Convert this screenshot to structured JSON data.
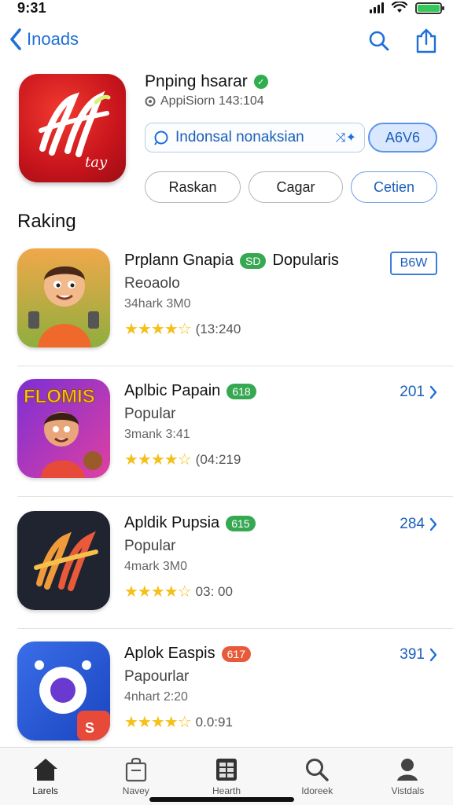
{
  "status": {
    "time": "9:31",
    "battery_level": 1.0,
    "battery_color": "#34c759"
  },
  "nav": {
    "back_label": "Inoads",
    "accent": "#1e6fd9"
  },
  "app": {
    "title": "Pnping hsarar",
    "subtitle": "AppiSiorn 143:104",
    "search_text": "Indonsal nonaksian",
    "primary_button": "A6V6",
    "chips": [
      "Raskan",
      "Cagar",
      "Cetien"
    ]
  },
  "section": {
    "title": "Raking"
  },
  "rows": [
    {
      "title": "Prplann Gnapia",
      "badge": "SD",
      "badge_color": "green",
      "extra": "Dopularis",
      "sub": "Reoaolo",
      "meta": "34hark 3M0",
      "stars": "★★★★☆",
      "rating_count": "(13:240",
      "action": "B6W",
      "action_style": "box"
    },
    {
      "title": "Aplbic Papain",
      "badge": "618",
      "badge_color": "green",
      "extra": "",
      "sub": "Popular",
      "meta": "3mank 3:41",
      "stars": "★★★★☆",
      "rating_count": "(04:219",
      "action": "201",
      "action_style": "link"
    },
    {
      "title": "Apldik Pupsia",
      "badge": "615",
      "badge_color": "green",
      "extra": "",
      "sub": "Popular",
      "meta": "4mark 3M0",
      "stars": "★★★★☆",
      "rating_count": "03: 00",
      "action": "284",
      "action_style": "link"
    },
    {
      "title": "Aplok Easpis",
      "badge": "617",
      "badge_color": "orange",
      "extra": "",
      "sub": "Papourlar",
      "meta": "4nhart 2:20",
      "stars": "★★★★☆",
      "rating_count": "0.0:91",
      "action": "391",
      "action_style": "link"
    }
  ],
  "tabs": [
    {
      "label": "Larels",
      "icon": "home-icon"
    },
    {
      "label": "Navey",
      "icon": "bag-icon"
    },
    {
      "label": "Hearth",
      "icon": "grid-icon"
    },
    {
      "label": "Idoreek",
      "icon": "search-icon"
    },
    {
      "label": "Vistdals",
      "icon": "person-icon"
    }
  ]
}
